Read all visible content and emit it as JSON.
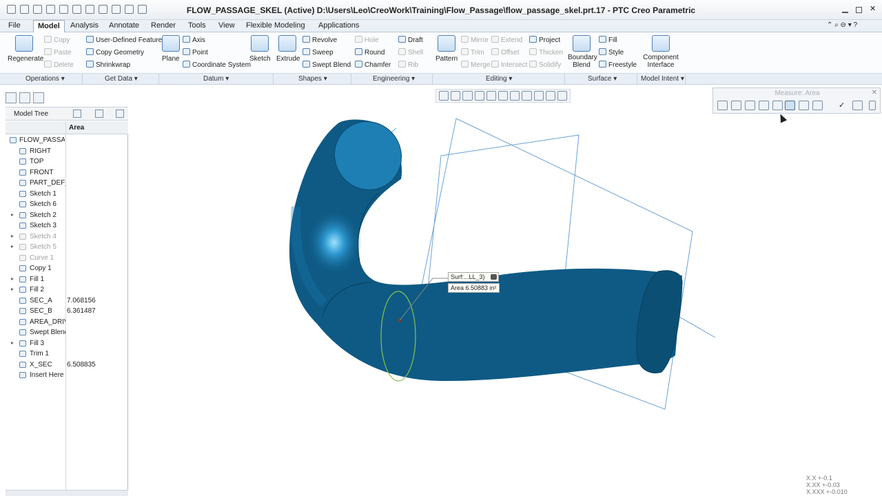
{
  "window": {
    "title": "FLOW_PASSAGE_SKEL (Active) D:\\Users\\Leo\\CreoWork\\Training\\Flow_Passage\\flow_passage_skel.prt.17 - PTC Creo Parametric"
  },
  "menu": {
    "tabs": [
      "File",
      "Model",
      "Analysis",
      "Annotate",
      "Render",
      "Tools",
      "View",
      "Flexible Modeling",
      "Applications"
    ],
    "active": "Model"
  },
  "ribbon": {
    "operations": {
      "regenerate": "Regenerate",
      "copy": "Copy",
      "paste": "Paste",
      "delete": "Delete"
    },
    "get_data": {
      "udf": "User-Defined Feature",
      "copy_geometry": "Copy Geometry",
      "shrinkwrap": "Shrinkwrap"
    },
    "datum": {
      "plane": "Plane",
      "axis": "Axis",
      "point": "Point",
      "csys": "Coordinate System",
      "sketch": "Sketch"
    },
    "shapes": {
      "extrude": "Extrude",
      "revolve": "Revolve",
      "sweep": "Sweep",
      "swept_blend": "Swept Blend"
    },
    "engineering": {
      "hole": "Hole",
      "round": "Round",
      "chamfer": "Chamfer",
      "draft": "Draft",
      "shell": "Shell",
      "rib": "Rib"
    },
    "editing": {
      "pattern": "Pattern",
      "mirror": "Mirror",
      "trim": "Trim",
      "merge": "Merge",
      "extend": "Extend",
      "offset": "Offset",
      "intersect": "Intersect",
      "project": "Project",
      "thicken": "Thicken",
      "solidify": "Solidify"
    },
    "surface": {
      "boundary_blend": "Boundary Blend",
      "fill": "Fill",
      "style": "Style",
      "freestyle": "Freestyle"
    },
    "model_intent": {
      "component_interface": "Component Interface"
    },
    "groups": [
      "Operations ▾",
      "Get Data ▾",
      "Datum ▾",
      "Shapes ▾",
      "Engineering ▾",
      "Editing ▾",
      "Surface ▾",
      "Model Intent ▾"
    ]
  },
  "tree": {
    "title": "Model Tree",
    "column": "Area",
    "rows": [
      {
        "label": "FLOW_PASSAGE_SKEL.PRT",
        "value": "",
        "exp": "",
        "dim": false
      },
      {
        "label": "RIGHT",
        "value": "",
        "exp": "",
        "dim": false
      },
      {
        "label": "TOP",
        "value": "",
        "exp": "",
        "dim": false
      },
      {
        "label": "FRONT",
        "value": "",
        "exp": "",
        "dim": false
      },
      {
        "label": "PART_DEF_CSYS",
        "value": "",
        "exp": "",
        "dim": false
      },
      {
        "label": "Sketch 1",
        "value": "",
        "exp": "",
        "dim": false
      },
      {
        "label": "Sketch 6",
        "value": "",
        "exp": "",
        "dim": false
      },
      {
        "label": "Sketch 2",
        "value": "",
        "exp": "▸",
        "dim": false
      },
      {
        "label": "Sketch 3",
        "value": "",
        "exp": "",
        "dim": false
      },
      {
        "label": "Sketch 4",
        "value": "",
        "exp": "▸",
        "dim": true
      },
      {
        "label": "Sketch 5",
        "value": "",
        "exp": "▸",
        "dim": true
      },
      {
        "label": "Curve 1",
        "value": "",
        "exp": "",
        "dim": true
      },
      {
        "label": "Copy 1",
        "value": "",
        "exp": "",
        "dim": false
      },
      {
        "label": "Fill 1",
        "value": "",
        "exp": "▸",
        "dim": false
      },
      {
        "label": "Fill 2",
        "value": "",
        "exp": "▸",
        "dim": false
      },
      {
        "label": "SEC_A",
        "value": "7.068156",
        "exp": "",
        "dim": false
      },
      {
        "label": "SEC_B",
        "value": "6.361487",
        "exp": "",
        "dim": false
      },
      {
        "label": "AREA_DRIVER",
        "value": "",
        "exp": "",
        "dim": false
      },
      {
        "label": "Swept Blend",
        "value": "",
        "exp": "",
        "dim": false
      },
      {
        "label": "Fill 3",
        "value": "",
        "exp": "▸",
        "dim": false
      },
      {
        "label": "Trim 1",
        "value": "",
        "exp": "",
        "dim": false
      },
      {
        "label": "X_SEC",
        "value": "6.508835",
        "exp": "",
        "dim": false
      },
      {
        "label": "Insert Here",
        "value": "",
        "exp": "",
        "dim": false
      }
    ]
  },
  "measure": {
    "title": "Measure: Area"
  },
  "callout": {
    "surf": "Surf:...LL_3)",
    "area": "Area  6.50883  in²"
  },
  "coords": [
    "X.X +-0.1",
    "X.XX +-0.03",
    "X.XXX +-0.010"
  ],
  "colors": {
    "solid": "#0e5a85",
    "solid_light": "#1d7fb3",
    "plane": "#6aa2d6",
    "section": "#8bc34a"
  }
}
